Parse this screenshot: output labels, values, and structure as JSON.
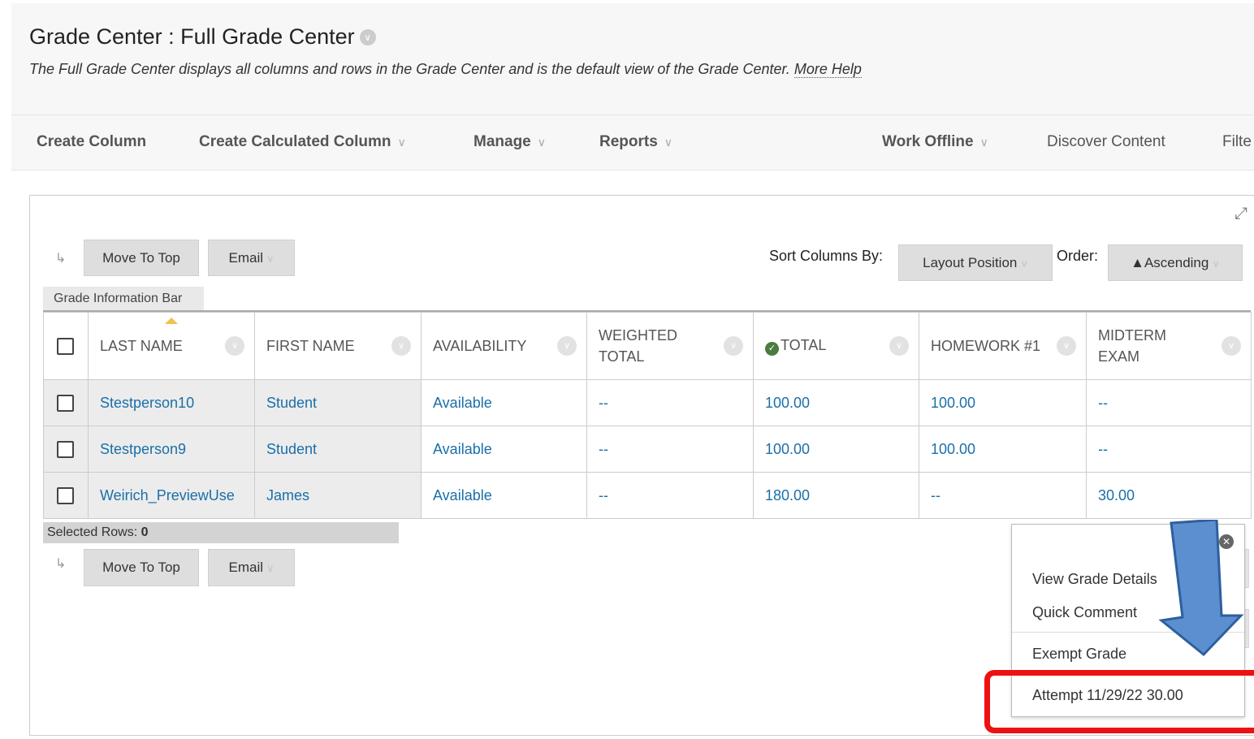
{
  "header": {
    "title": "Grade Center : Full Grade Center",
    "description": "The Full Grade Center displays all columns and rows in the Grade Center and is the default view of the Grade Center.",
    "more_help": "More Help"
  },
  "action_bar": {
    "create_column": "Create Column",
    "create_calculated_column": "Create Calculated Column",
    "manage": "Manage",
    "reports": "Reports",
    "work_offline": "Work Offline",
    "discover_content": "Discover Content",
    "filter": "Filte"
  },
  "toolbar": {
    "move_to_top": "Move To Top",
    "email": "Email",
    "sort_columns_by_label": "Sort Columns By:",
    "sort_columns_value": "Layout Position",
    "order_label": "Order:",
    "order_value": "▲Ascending"
  },
  "grade_info_bar": "Grade Information Bar",
  "columns": {
    "last_name": "LAST NAME",
    "first_name": "FIRST NAME",
    "availability": "AVAILABILITY",
    "weighted_total": "WEIGHTED TOTAL",
    "total": "TOTAL",
    "homework1": "HOMEWORK #1",
    "midterm": "MIDTERM EXAM"
  },
  "rows": [
    {
      "last_name": "Stestperson10",
      "first_name": "Student",
      "availability": "Available",
      "weighted_total": "--",
      "total": "100.00",
      "homework1": "100.00",
      "midterm": "--"
    },
    {
      "last_name": "Stestperson9",
      "first_name": "Student",
      "availability": "Available",
      "weighted_total": "--",
      "total": "100.00",
      "homework1": "100.00",
      "midterm": "--"
    },
    {
      "last_name": "Weirich_PreviewUse",
      "first_name": "James",
      "availability": "Available",
      "weighted_total": "--",
      "total": "180.00",
      "homework1": "--",
      "midterm": "30.00"
    }
  ],
  "selected_rows": {
    "label": "Selected Rows: ",
    "count": "0"
  },
  "context_menu": {
    "view_grade_details": "View Grade Details",
    "quick_comment": "Quick Comment",
    "exempt_grade": "Exempt Grade",
    "attempt": "Attempt 11/29/22 30.00"
  },
  "colors": {
    "link": "#1a6fa8",
    "highlight_box": "#ee1111",
    "callout_arrow": "#5b8fd0",
    "sort_indicator": "#f0c24a"
  }
}
